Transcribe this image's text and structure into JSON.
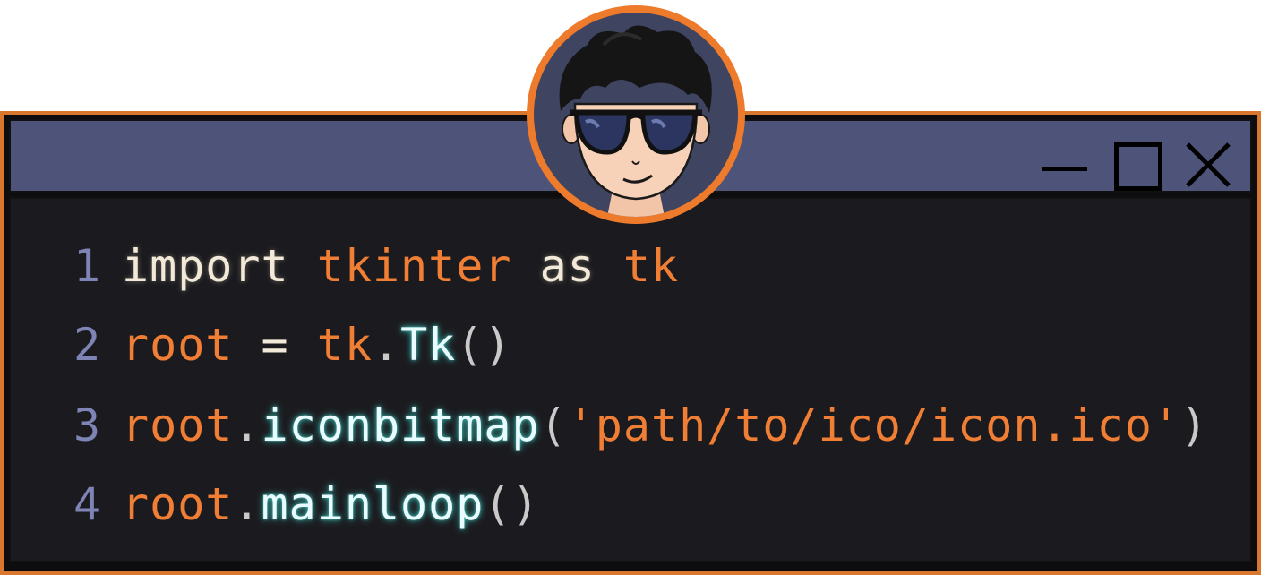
{
  "window": {
    "controls": {
      "minimize_icon": "minimize-icon",
      "maximize_icon": "maximize-icon",
      "close_icon": "close-icon"
    },
    "accent_color": "#d9772e",
    "titlebar_color": "#4d5379"
  },
  "avatar": {
    "icon": "cartoon-avatar-with-sunglasses"
  },
  "code": {
    "lines": [
      {
        "number": "1",
        "tokens": [
          {
            "text": "import",
            "type": "kw"
          },
          {
            "text": " ",
            "type": "op"
          },
          {
            "text": "tkinter",
            "type": "mod"
          },
          {
            "text": " ",
            "type": "op"
          },
          {
            "text": "as",
            "type": "kw"
          },
          {
            "text": " ",
            "type": "op"
          },
          {
            "text": "tk",
            "type": "mod"
          }
        ]
      },
      {
        "number": "2",
        "tokens": [
          {
            "text": "root",
            "type": "var"
          },
          {
            "text": " = ",
            "type": "op"
          },
          {
            "text": "tk",
            "type": "mod"
          },
          {
            "text": ".",
            "type": "punc"
          },
          {
            "text": "Tk",
            "type": "fn"
          },
          {
            "text": "()",
            "type": "punc"
          }
        ]
      },
      {
        "number": "3",
        "tokens": [
          {
            "text": "root",
            "type": "var"
          },
          {
            "text": ".",
            "type": "punc"
          },
          {
            "text": "iconbitmap",
            "type": "fn"
          },
          {
            "text": "(",
            "type": "punc"
          },
          {
            "text": "'path/to/ico/icon.ico'",
            "type": "str"
          },
          {
            "text": ")",
            "type": "punc"
          }
        ]
      },
      {
        "number": "4",
        "tokens": [
          {
            "text": "root",
            "type": "var"
          },
          {
            "text": ".",
            "type": "punc"
          },
          {
            "text": "mainloop",
            "type": "fn"
          },
          {
            "text": "()",
            "type": "punc"
          }
        ]
      }
    ]
  }
}
